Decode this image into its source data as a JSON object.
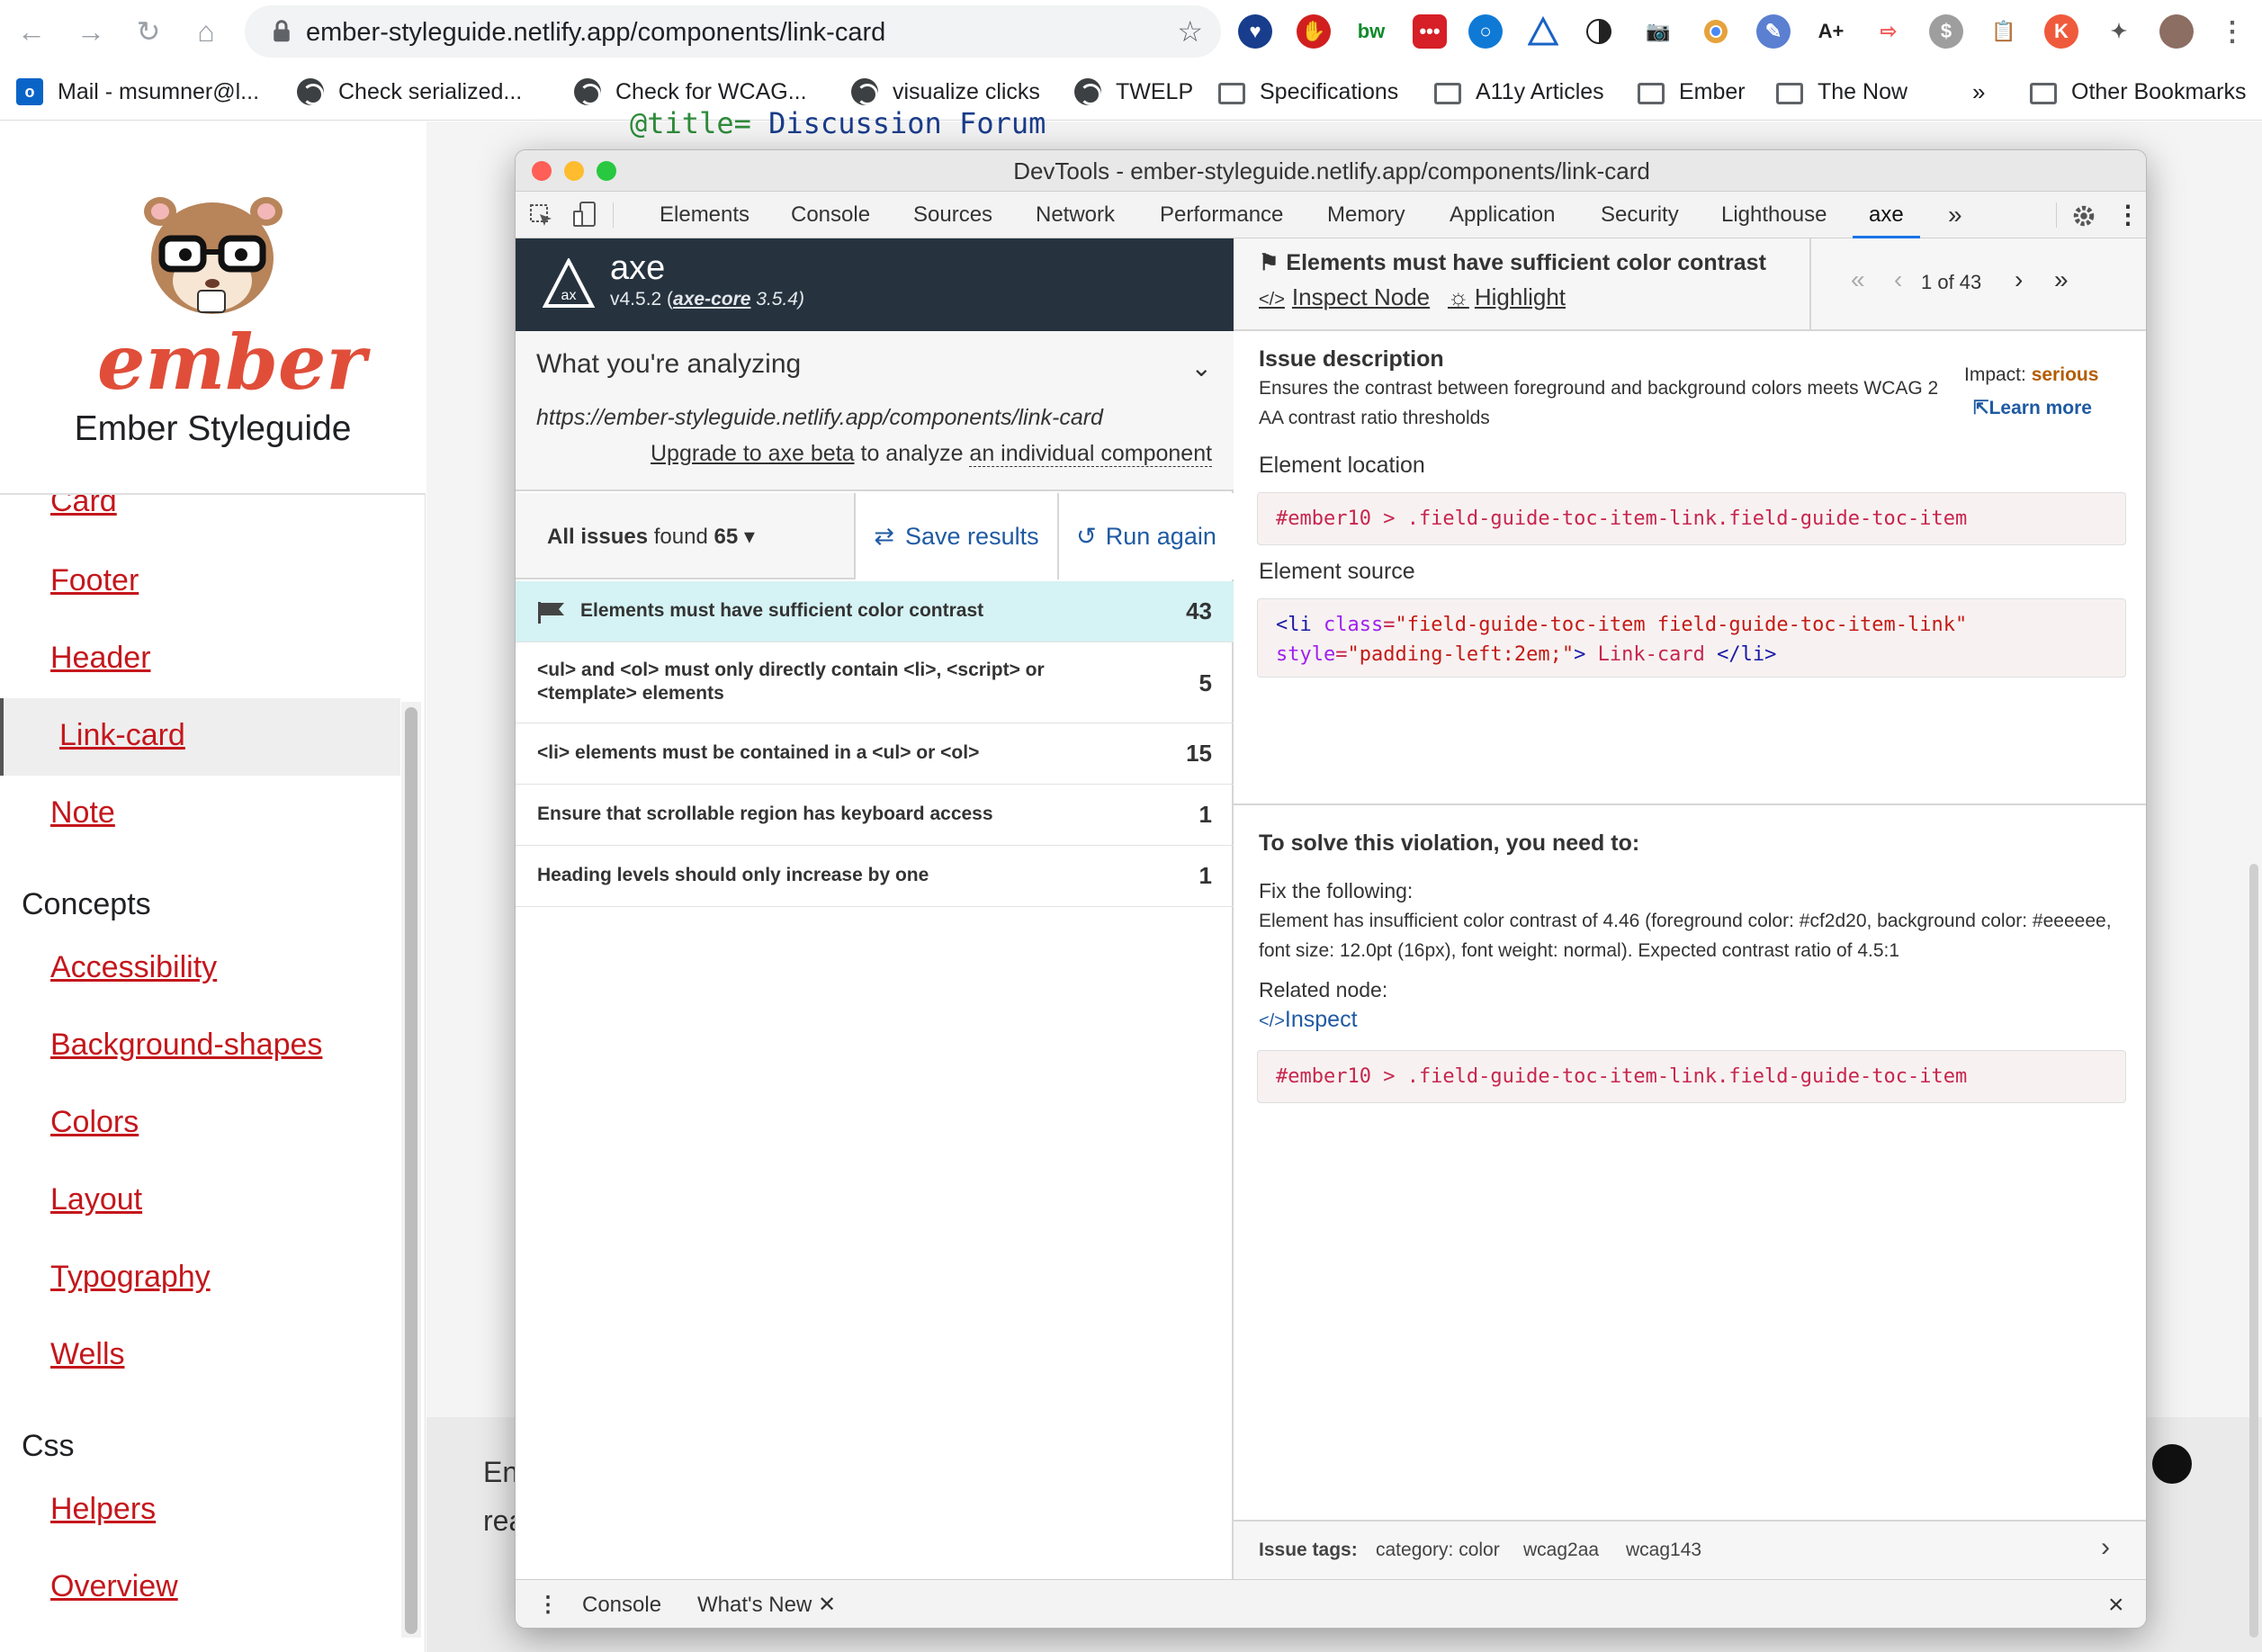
{
  "browser": {
    "url": "ember-styleguide.netlify.app/components/link-card",
    "bookmarks": [
      {
        "label": "Mail - msumner@l...",
        "icon": "outlook-icon"
      },
      {
        "label": "Check serialized...",
        "icon": "globe-icon"
      },
      {
        "label": "Check for WCAG...",
        "icon": "globe-icon"
      },
      {
        "label": "visualize clicks",
        "icon": "globe-icon"
      },
      {
        "label": "TWELP",
        "icon": "globe-icon"
      },
      {
        "label": "Specifications",
        "icon": "folder-icon"
      },
      {
        "label": "A11y Articles",
        "icon": "folder-icon"
      },
      {
        "label": "Ember",
        "icon": "folder-icon"
      },
      {
        "label": "The Now",
        "icon": "folder-icon"
      },
      {
        "label": "Other Bookmarks",
        "icon": "folder-icon"
      }
    ],
    "bookmarks_overflow": "»",
    "ext_labels": {
      "bw": "bw",
      "aplus": "A+"
    }
  },
  "page": {
    "brand": "Ember Styleguide",
    "logo_text": "ember",
    "code_peek": {
      "keyword": "@title=",
      "value": "Discussion Forum"
    },
    "nav": [
      {
        "label": "Card",
        "type": "link"
      },
      {
        "label": "Footer",
        "type": "link"
      },
      {
        "label": "Header",
        "type": "link"
      },
      {
        "label": "Link-card",
        "type": "link",
        "active": true
      },
      {
        "label": "Note",
        "type": "link"
      },
      {
        "label": "Concepts",
        "type": "section"
      },
      {
        "label": "Accessibility",
        "type": "link"
      },
      {
        "label": "Background-shapes",
        "type": "link"
      },
      {
        "label": "Colors",
        "type": "link"
      },
      {
        "label": "Layout",
        "type": "link"
      },
      {
        "label": "Typography",
        "type": "link"
      },
      {
        "label": "Wells",
        "type": "link"
      },
      {
        "label": "Css",
        "type": "section"
      },
      {
        "label": "Helpers",
        "type": "link"
      },
      {
        "label": "Overview",
        "type": "link"
      }
    ],
    "footer_text_1": "En",
    "footer_text_2": "rea"
  },
  "devtools": {
    "title": "DevTools - ember-styleguide.netlify.app/components/link-card",
    "tabs": [
      "Elements",
      "Console",
      "Sources",
      "Network",
      "Performance",
      "Memory",
      "Application",
      "Security",
      "Lighthouse",
      "axe"
    ],
    "active_tab": "axe",
    "overflow": "»",
    "drawer": {
      "tabs": [
        "Console",
        "What's New"
      ],
      "active": "What's New",
      "close": "×"
    }
  },
  "axe": {
    "name": "axe",
    "version_prefix": "v4.5.2 (",
    "core_name": "axe-core",
    "core_version": " 3.5.4)",
    "analyzing": {
      "title": "What you're analyzing",
      "url": "https://ember-styleguide.netlify.app/components/link-card",
      "upgrade_link": "Upgrade to axe beta",
      "upgrade_mid": " to analyze ",
      "upgrade_tail": "an individual component"
    },
    "issues": {
      "filter_label": "All issues",
      "found_label": "found",
      "found_count": "65",
      "save": "Save results",
      "run": "Run again",
      "list": [
        {
          "label": "Elements must have sufficient color contrast",
          "count": "43",
          "selected": true
        },
        {
          "label": "<ul> and <ol> must only directly contain <li>, <script> or <template> elements",
          "count": "5"
        },
        {
          "label": "<li> elements must be contained in a <ul> or <ol>",
          "count": "15"
        },
        {
          "label": "Ensure that scrollable region has keyboard access",
          "count": "1"
        },
        {
          "label": "Heading levels should only increase by one",
          "count": "1"
        }
      ]
    },
    "detail": {
      "rule_title": "Elements must have sufficient color contrast",
      "inspect_node": "Inspect Node",
      "highlight": "Highlight",
      "pager": "1 of 43",
      "issue_desc_title": "Issue description",
      "issue_desc": "Ensures the contrast between foreground and background colors meets WCAG 2 AA contrast ratio thresholds",
      "impact_label": "Impact:",
      "impact_value": "serious",
      "learn_more": "Learn more",
      "location_title": "Element location",
      "location": "#ember10 > .field-guide-toc-item-link.field-guide-toc-item",
      "source_title": "Element source",
      "source": {
        "open": "<li",
        "class_attr": "class",
        "class_val": "\"field-guide-toc-item field-guide-toc-item-link\"",
        "style_attr": "style",
        "style_val": "\"padding-left:2em;\"",
        "close": ">",
        "text": "Link-card",
        "end": "</li>"
      },
      "solve_title": "To solve this violation, you need to:",
      "fix_title": "Fix the following:",
      "fix_text": "Element has insufficient color contrast of 4.46 (foreground color: #cf2d20, background color: #eeeeee, font size: 12.0pt (16px), font weight: normal). Expected contrast ratio of 4.5:1",
      "related_title": "Related node:",
      "inspect": "Inspect",
      "related": "#ember10 > .field-guide-toc-item-link.field-guide-toc-item",
      "tags_label": "Issue tags:",
      "tags": [
        "category: color",
        "wcag2aa",
        "wcag143"
      ]
    }
  },
  "colors": {
    "accent": "#1a73e8",
    "axe_dark": "#26333f",
    "ember_red": "#c4171c",
    "serious": "#b35c00",
    "selected_row": "#d5f2f4"
  }
}
